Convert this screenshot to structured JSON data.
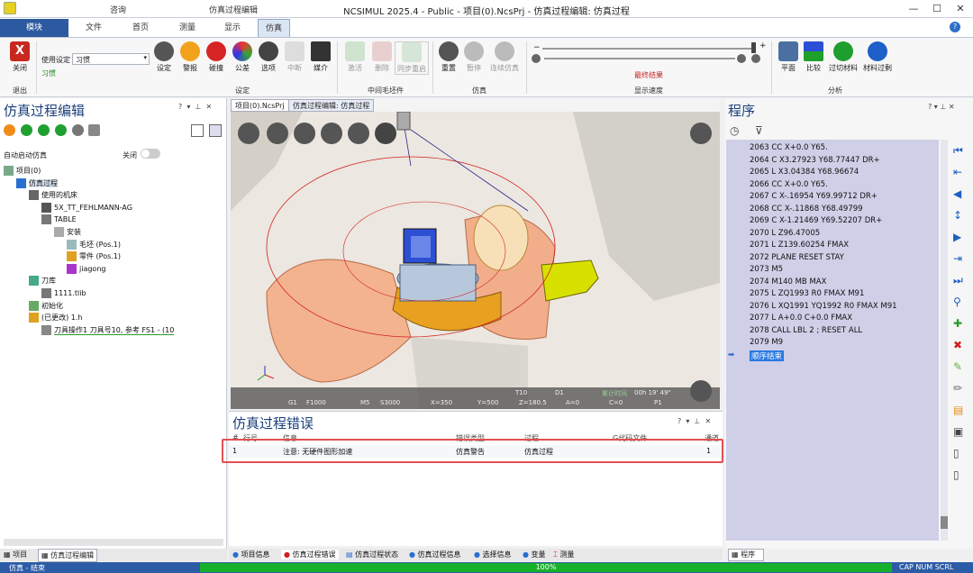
{
  "window": {
    "title": "NCSIMUL 2025.4 - Public - 项目(0).NcsPrj - 仿真过程编辑: 仿真过程",
    "context_group": "仿真过程编辑",
    "query_tab": "咨询",
    "min": "—",
    "max": "☐",
    "close": "✕"
  },
  "menu_tabs": [
    "模块",
    "文件",
    "首页",
    "测量",
    "显示",
    "仿真"
  ],
  "ribbon": {
    "exit_label": "关闭",
    "exit_group": "退出",
    "use_settings_label": "使用设定",
    "use_settings_value": "习惯",
    "use_settings_sub": "习惯",
    "settings_buttons": [
      "设定",
      "警报",
      "碰撞",
      "公差",
      "选项",
      "中断",
      "媒介"
    ],
    "settings_group": "设定",
    "stock_buttons": [
      "激活",
      "删除",
      "同步重启"
    ],
    "stock_group": "中间毛坯件",
    "sim_buttons": [
      "重置",
      "暂停",
      "连续仿真"
    ],
    "sim_group": "仿真",
    "display_speed_group": "显示速度",
    "final_result": "最终结果",
    "analysis_buttons": [
      "平面",
      "比较",
      "过切材料",
      "材料过剩"
    ],
    "analysis_group": "分析"
  },
  "left_panel": {
    "title": "仿真过程编辑",
    "auto_start_label": "自动启动仿真",
    "auto_start_state": "关闭",
    "tree": [
      {
        "label": "项目(0)",
        "level": 0
      },
      {
        "label": "仿真过程",
        "level": 1
      },
      {
        "label": "使用的机床",
        "level": 2
      },
      {
        "label": "5X_TT_FEHLMANN-AG",
        "level": 3
      },
      {
        "label": "TABLE",
        "level": 3
      },
      {
        "label": "安装",
        "level": 4
      },
      {
        "label": "毛坯 (Pos.1)",
        "level": 5
      },
      {
        "label": "零件 (Pos.1)",
        "level": 5
      },
      {
        "label": "jiagong",
        "level": 5
      },
      {
        "label": "刀库",
        "level": 2
      },
      {
        "label": "1111.tlib",
        "level": 3
      },
      {
        "label": "初始化",
        "level": 2
      },
      {
        "label": "(已更改) 1.h",
        "level": 2
      },
      {
        "label": "刀具操作1 刀具号10, 参考 FS1 - (10",
        "level": 3
      }
    ],
    "bottom_tabs": [
      "项目",
      "仿真过程编辑"
    ]
  },
  "doc_tabs": [
    "项目(0).NcsPrj",
    "仿真过程编辑: 仿真过程"
  ],
  "hud": {
    "t": "T10",
    "d": "D1",
    "time_label": "累计时间",
    "time": "00h 19' 49\"",
    "g": "G1",
    "f": "F1000",
    "m": "M5",
    "s": "S3000",
    "x": "X=350",
    "y": "Y=500",
    "z": "Z=180.5",
    "a": "A=0",
    "c": "C=0",
    "p": "P1"
  },
  "errors": {
    "title": "仿真过程错误",
    "headers": [
      "#",
      "行号",
      "信息",
      "错误类型",
      "过程",
      "G代码文件",
      "通道"
    ],
    "rows": [
      {
        "num": "1",
        "line": "",
        "info": "注意: 无硬件图形加速",
        "type": "仿真警告",
        "process": "仿真过程",
        "file": "",
        "channel": "1"
      }
    ]
  },
  "bottom_tabs": [
    "项目信息",
    "仿真过程错误",
    "仿真过程状态",
    "仿真过程信息",
    "选择信息",
    "变量",
    "测量"
  ],
  "program": {
    "title": "程序",
    "lines": [
      "2063 CC X+0.0 Y65.",
      "2064 C X3.27923 Y68.77447 DR+",
      "2065 L X3.04384 Y68.96674",
      "2066 CC X+0.0 Y65.",
      "2067 C X-.16954 Y69.99712 DR+",
      "2068 CC X-.11868 Y68.49799",
      "2069 C X-1.21469 Y69.52207 DR+",
      "2070 L Z96.47005",
      "2071 L Z139.60254 FMAX",
      "2072 PLANE RESET STAY",
      "2073 M5",
      "2074 M140 MB MAX",
      "2075 L ZQ1993 R0 FMAX M91",
      "2076 L XQ1991 YQ1992 R0 FMAX M91",
      "2077 L A+0.0 C+0.0 FMAX",
      "2078 CALL LBL 2 ; RESET ALL",
      "2079 M9"
    ],
    "end_label": "顺序结束",
    "tab": "程序"
  },
  "status": {
    "left": "仿真 - 结束",
    "progress": "100%",
    "progress_fraction": 1.0,
    "right": "CAP NUM SCRL"
  }
}
